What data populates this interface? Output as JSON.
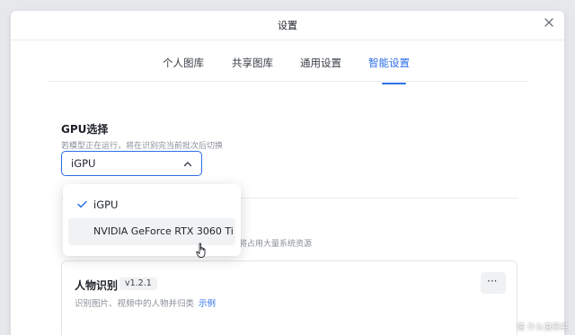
{
  "dialog": {
    "title": "设置",
    "close_icon": "close-icon"
  },
  "tabs": [
    {
      "label": "个人图库",
      "active": false
    },
    {
      "label": "共享图库",
      "active": false
    },
    {
      "label": "通用设置",
      "active": false
    },
    {
      "label": "智能设置",
      "active": true
    }
  ],
  "gpu_section": {
    "title": "GPU选择",
    "description": "若模型正在运行，将在识别完当前批次后切换",
    "selected_value": "iGPU",
    "chevron_icon": "chevron-up-icon"
  },
  "dropdown": {
    "options": [
      {
        "label": "iGPU",
        "checked": true
      },
      {
        "label": "NVIDIA GeForce RTX 3060 Ti",
        "checked": false,
        "hovered": true
      }
    ]
  },
  "background_text": {
    "partial_description": "将占用大量系统资源"
  },
  "card": {
    "title": "人物识别",
    "version": "v1.2.1",
    "description": "识别图片、视频中的人物并归类",
    "example_link": "示例",
    "more_label": "···"
  },
  "watermark": "值 什么值得买",
  "colors": {
    "accent": "#2b6fe8",
    "text_primary": "#1f2329",
    "text_secondary": "#8a8f99"
  }
}
